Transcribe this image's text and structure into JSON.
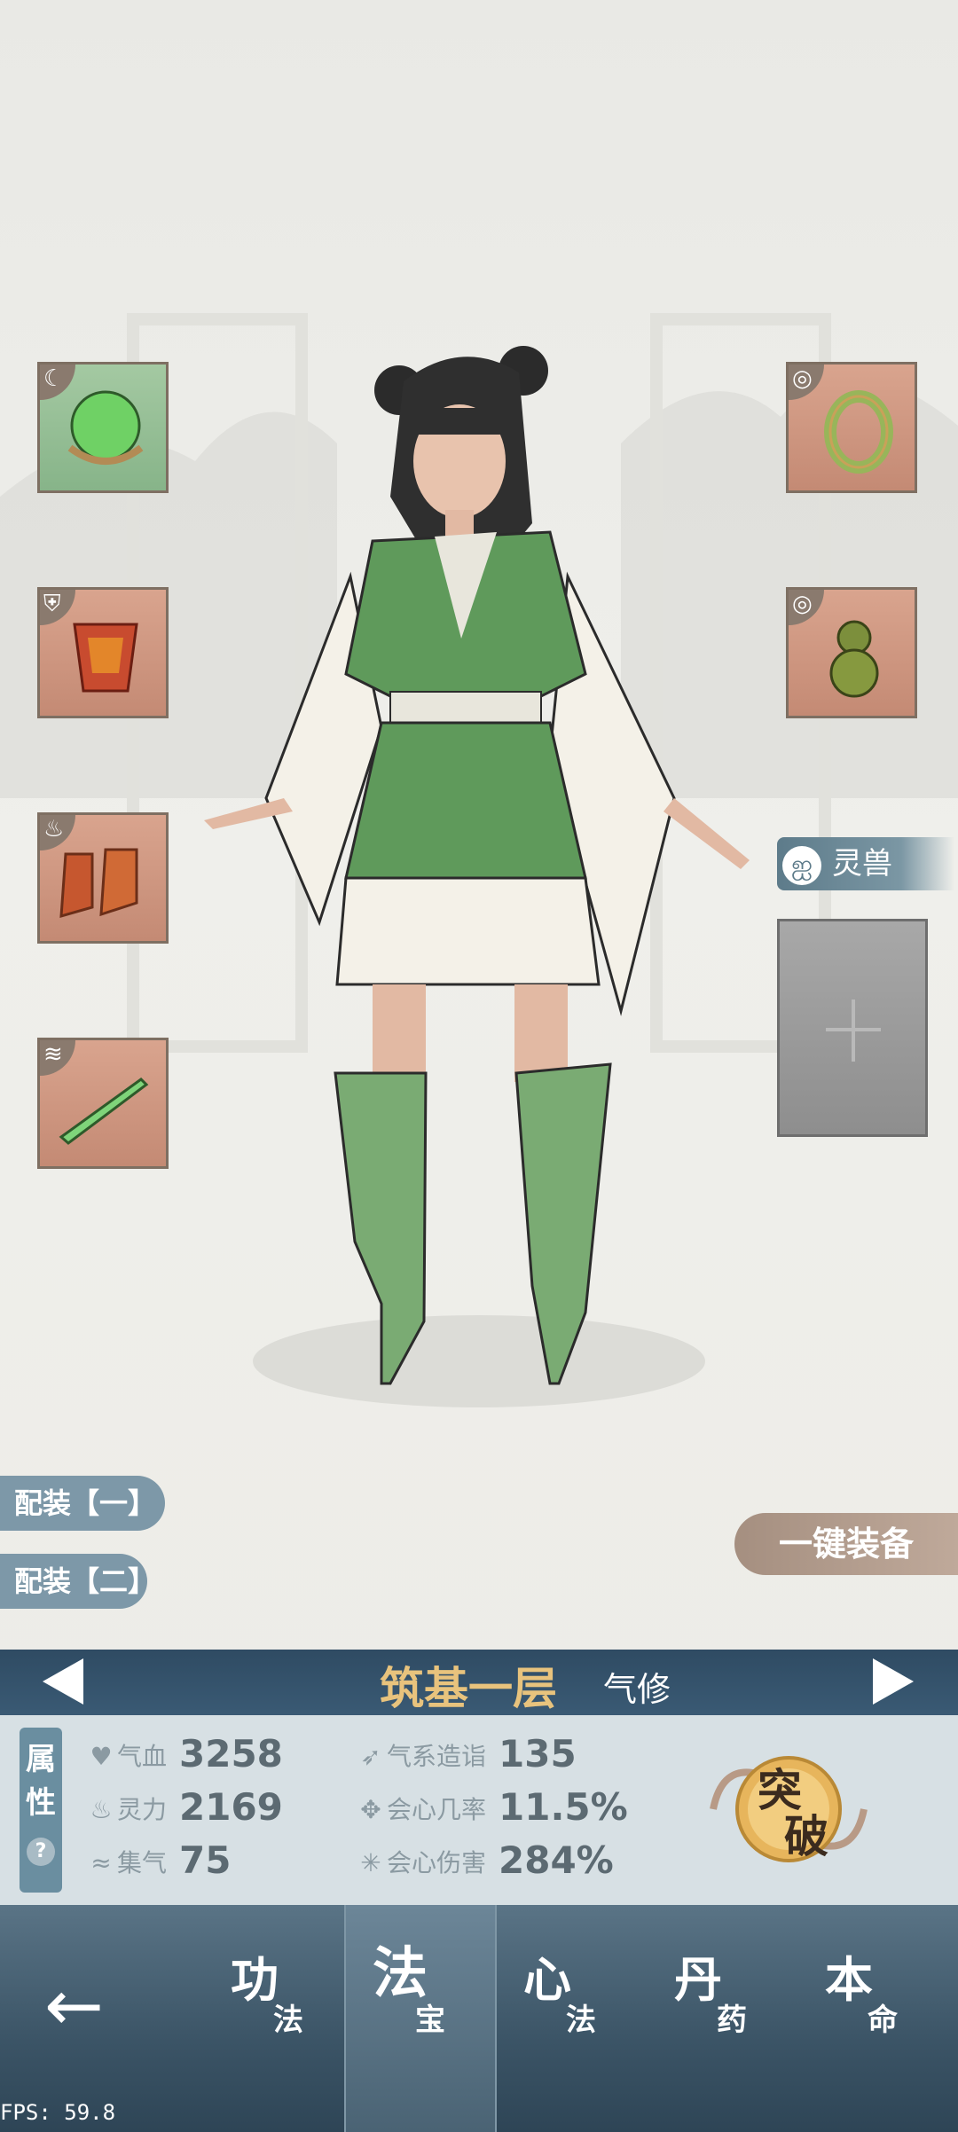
{
  "equipment": {
    "left_slots": [
      {
        "item": "green-orb-icon",
        "badge": "moon-icon",
        "bg": "green"
      },
      {
        "item": "armor-icon",
        "badge": "chest-icon",
        "bg": "red"
      },
      {
        "item": "boots-icon",
        "badge": "boot-icon",
        "bg": "red"
      },
      {
        "item": "sword-icon",
        "badge": "wing-icon",
        "bg": "red"
      }
    ],
    "right_slots": [
      {
        "item": "bracelet-icon",
        "badge": "ring-icon",
        "bg": "red"
      },
      {
        "item": "gourd-icon",
        "badge": "ring-icon",
        "bg": "red"
      }
    ]
  },
  "pet": {
    "label": "灵兽"
  },
  "loadouts": [
    "配装【一】",
    "配装【二】"
  ],
  "equip_all_label": "一键装备",
  "realm": {
    "title": "筑基一层",
    "type": "气修"
  },
  "attributes": {
    "tab_label_1": "属",
    "tab_label_2": "性",
    "help": "?",
    "items": [
      {
        "icon": "heart-icon",
        "label": "气血",
        "value": "3258"
      },
      {
        "icon": "flame-icon",
        "label": "灵力",
        "value": "2169"
      },
      {
        "icon": "swirl-icon",
        "label": "集气",
        "value": "75"
      },
      {
        "icon": "wind-icon",
        "label": "气系造诣",
        "value": "135"
      },
      {
        "icon": "crit-icon",
        "label": "会心几率",
        "value": "11.5%"
      },
      {
        "icon": "star-icon",
        "label": "会心伤害",
        "value": "284%"
      }
    ],
    "breakthrough_1": "突",
    "breakthrough_2": "破"
  },
  "nav": {
    "back": "←",
    "tabs": [
      {
        "big": "功",
        "small": "法"
      },
      {
        "big": "法",
        "small": "宝",
        "active": true
      },
      {
        "big": "心",
        "small": "法"
      },
      {
        "big": "丹",
        "small": "药"
      },
      {
        "big": "本",
        "small": "命"
      }
    ]
  },
  "fps": "FPS: 59.8",
  "colors": {
    "realm_gold": "#e8c37d",
    "nav_bg": "#3b5466",
    "slot_red": "#c48a74",
    "slot_green": "#87b489"
  }
}
